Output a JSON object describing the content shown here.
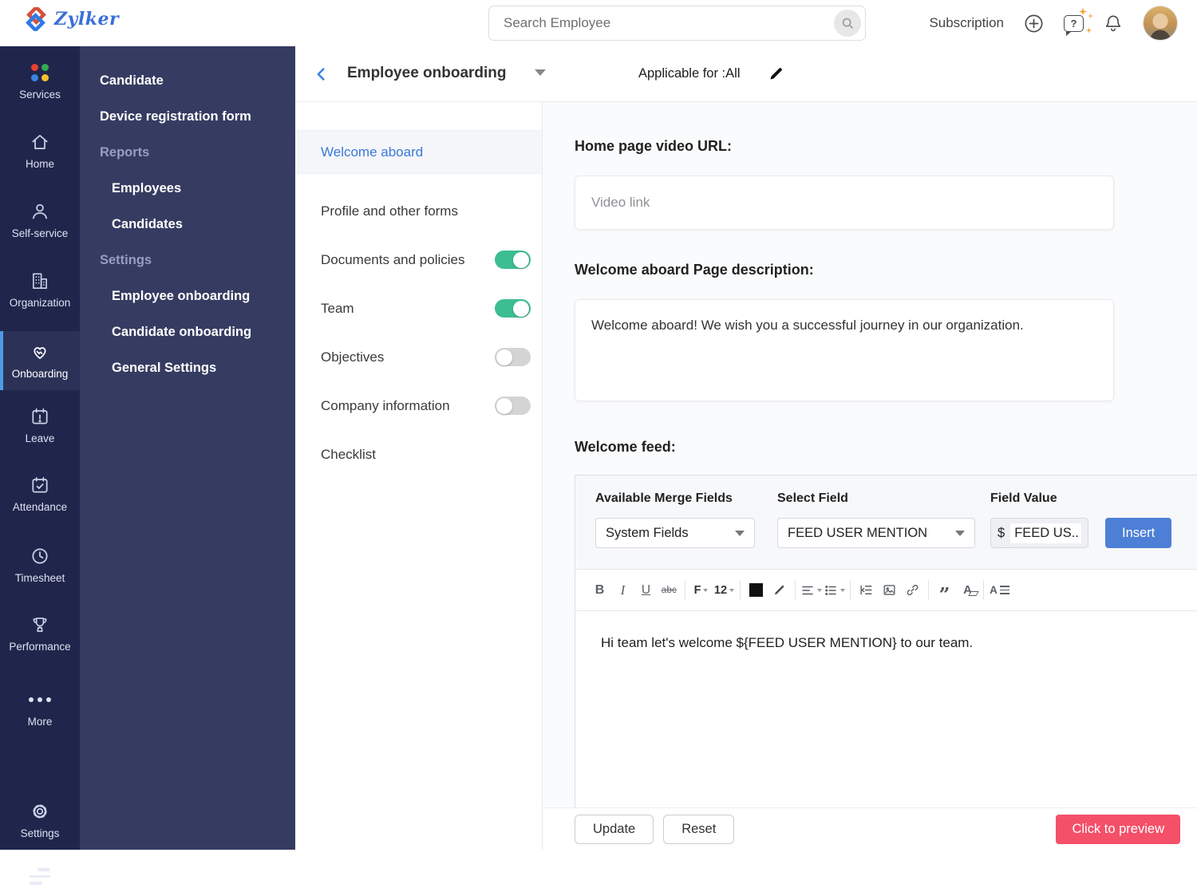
{
  "topbar": {
    "brand": "Zylker",
    "search": {
      "placeholder": "Search Employee",
      "icon": "search-icon"
    },
    "subscription_label": "Subscription",
    "icons": [
      "add-icon",
      "help-icon",
      "notifications-icon",
      "user-avatar"
    ]
  },
  "rail": {
    "items": [
      {
        "label": "Services",
        "icon": "apps-grid-icon"
      },
      {
        "label": "Home",
        "icon": "home-icon"
      },
      {
        "label": "Self-service",
        "icon": "person-icon"
      },
      {
        "label": "Organization",
        "icon": "building-icon"
      },
      {
        "label": "Onboarding",
        "icon": "handshake-icon",
        "active": true
      },
      {
        "label": "Leave",
        "icon": "calendar-alert-icon"
      },
      {
        "label": "Attendance",
        "icon": "calendar-check-icon"
      },
      {
        "label": "Timesheet",
        "icon": "clock-icon"
      },
      {
        "label": "Performance",
        "icon": "trophy-icon"
      },
      {
        "label": "More",
        "icon": "ellipsis-icon"
      },
      {
        "label": "Settings",
        "icon": "gear-icon"
      }
    ]
  },
  "submenu": {
    "items": [
      {
        "label": "Candidate",
        "type": "link"
      },
      {
        "label": "Device registration form",
        "type": "link"
      },
      {
        "label": "Reports",
        "type": "header"
      },
      {
        "label": "Employees",
        "type": "sublink"
      },
      {
        "label": "Candidates",
        "type": "sublink"
      },
      {
        "label": "Settings",
        "type": "header"
      },
      {
        "label": "Employee onboarding",
        "type": "sublink"
      },
      {
        "label": "Candidate onboarding",
        "type": "sublink"
      },
      {
        "label": "General Settings",
        "type": "sublink"
      }
    ]
  },
  "header": {
    "title": "Employee onboarding",
    "applicable": "Applicable for :All"
  },
  "section_nav": {
    "items": [
      {
        "label": "Welcome aboard",
        "active": true
      },
      {
        "label": "Profile and other forms"
      },
      {
        "label": "Documents and policies",
        "toggle": "on"
      },
      {
        "label": "Team",
        "toggle": "on"
      },
      {
        "label": "Objectives",
        "toggle": "off"
      },
      {
        "label": "Company information",
        "toggle": "off"
      },
      {
        "label": "Checklist"
      }
    ]
  },
  "form": {
    "video_label": "Home page video URL:",
    "video_placeholder": "Video link",
    "desc_label": "Welcome aboard Page description:",
    "desc_value": "Welcome aboard! We wish you a successful journey in our organization.",
    "feed_label": "Welcome feed:",
    "merge": {
      "available_label": "Available Merge Fields",
      "select_label": "Select Field",
      "value_label": "Field Value",
      "available_value": "System Fields",
      "select_value": "FEED USER MENTION",
      "value_prefix": "$",
      "value_token": "FEED US..",
      "insert_label": "Insert"
    }
  },
  "editor": {
    "glyphs": {
      "bold": "B",
      "italic": "I",
      "underline": "U",
      "strike": "abc",
      "font": "F",
      "size": "12",
      "quote": "”",
      "clear": "A",
      "spacing": "A"
    },
    "content": "Hi team let's welcome ${FEED USER MENTION} to our team."
  },
  "footer": {
    "update_label": "Update",
    "reset_label": "Reset",
    "preview_label": "Click to preview"
  },
  "colors": {
    "rail_bg": "#20264b",
    "submenu_bg": "#363c61",
    "active_indicator": "#4c9be5",
    "link_blue": "#3a79d8",
    "toggle_on": "#3cbd92",
    "insert_blue": "#4d7fd6",
    "preview_red": "#f4506a"
  }
}
